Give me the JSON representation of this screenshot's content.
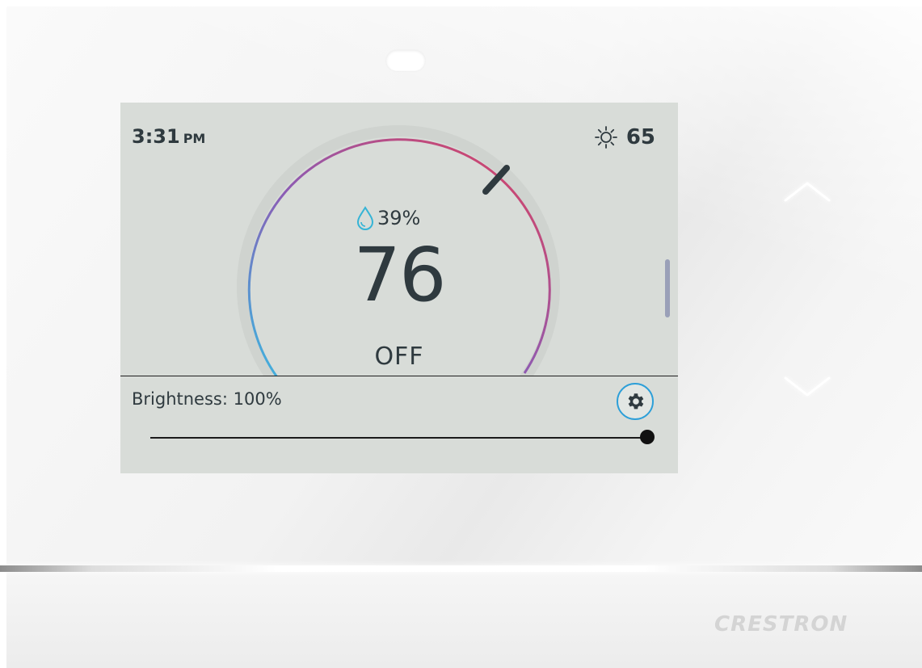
{
  "status_bar": {
    "time": "3:31",
    "ampm": "PM",
    "outdoor_temp": "65"
  },
  "thermostat": {
    "humidity": "39%",
    "setpoint": "76",
    "mode": "OFF"
  },
  "brightness": {
    "label": "Brightness: 100%",
    "value_percent": 100
  },
  "device": {
    "brand": "CRESTRON"
  },
  "colors": {
    "screen_bg": "#d8dcd8",
    "text": "#2f3a3f",
    "arc_cool": "#3bb6e0",
    "arc_mid": "#8c5bb4",
    "arc_warm": "#e0405a",
    "accent": "#2d9fd8",
    "humidity_icon": "#35b4d6"
  },
  "icons": {
    "weather": "sun-icon",
    "humidity": "water-drop-icon",
    "settings": "gear-icon",
    "up": "chevron-up-icon",
    "down": "chevron-down-icon"
  }
}
